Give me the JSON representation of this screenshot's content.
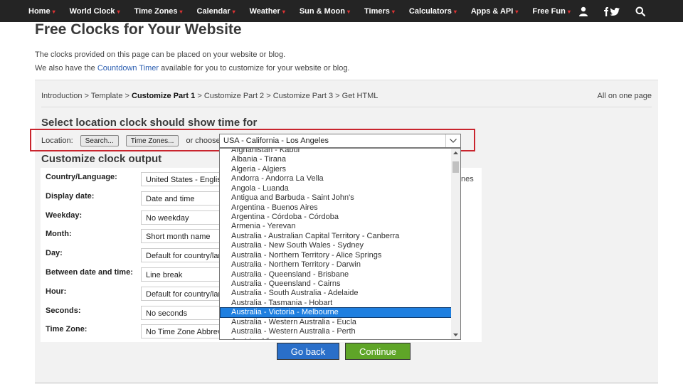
{
  "nav": {
    "items": [
      {
        "label": "Home",
        "caret": "▾"
      },
      {
        "label": "World Clock",
        "caret": "▾"
      },
      {
        "label": "Time Zones",
        "caret": "▾"
      },
      {
        "label": "Calendar",
        "caret": "▾"
      },
      {
        "label": "Weather",
        "caret": "▾"
      },
      {
        "label": "Sun & Moon",
        "caret": "▾"
      },
      {
        "label": "Timers",
        "caret": "▾"
      },
      {
        "label": "Calculators",
        "caret": "▾"
      },
      {
        "label": "Apps & API",
        "caret": "▾"
      },
      {
        "label": "Free Fun",
        "caret": "▾"
      }
    ],
    "icons": [
      "user-icon",
      "facebook-twitter-icon",
      "search-icon"
    ]
  },
  "page": {
    "title": "Free Clocks for Your Website",
    "intro1": "The clocks provided on this page can be placed on your website or blog.",
    "intro2_pre": "We also have the ",
    "intro2_link": "Countdown Timer",
    "intro2_post": " available for you to customize for your website or blog."
  },
  "breadcrumb": {
    "items": [
      "Introduction",
      "Template",
      "Customize Part 1",
      "Customize Part 2",
      "Customize Part 3",
      "Get HTML"
    ],
    "separator": " > ",
    "all_on_one": "All on one page"
  },
  "location": {
    "heading": "Select location clock should show time for",
    "label": "Location:",
    "search_btn": "Search...",
    "tz_btn": "Time Zones...",
    "or_choose": "or choose:",
    "selected": "USA - California - Los Angeles"
  },
  "customize": {
    "heading": "Customize clock output",
    "rows": [
      {
        "label": "Country/Language:",
        "value": "United States - English"
      },
      {
        "label": "Display date:",
        "value": "Date and time"
      },
      {
        "label": "Weekday:",
        "value": "No weekday"
      },
      {
        "label": "Month:",
        "value": "Short month name"
      },
      {
        "label": "Day:",
        "value": "Default for country/language"
      },
      {
        "label": "Between date and time:",
        "value": "Line break"
      },
      {
        "label": "Hour:",
        "value": "Default for country/language"
      },
      {
        "label": "Seconds:",
        "value": "No seconds"
      },
      {
        "label": "Time Zone:",
        "value": "No Time Zone Abbreviation"
      }
    ],
    "side_text": "nes"
  },
  "dropdown": {
    "options": [
      "Afghanistan - Kabul",
      "Albania - Tirana",
      "Algeria - Algiers",
      "Andorra - Andorra La Vella",
      "Angola - Luanda",
      "Antigua and Barbuda - Saint John's",
      "Argentina - Buenos Aires",
      "Argentina - Córdoba - Córdoba",
      "Armenia - Yerevan",
      "Australia - Australian Capital Territory - Canberra",
      "Australia - New South Wales - Sydney",
      "Australia - Northern Territory - Alice Springs",
      "Australia - Northern Territory - Darwin",
      "Australia - Queensland - Brisbane",
      "Australia - Queensland - Cairns",
      "Australia - South Australia - Adelaide",
      "Australia - Tasmania - Hobart",
      "Australia - Victoria - Melbourne",
      "Australia - Western Australia - Eucla",
      "Australia - Western Australia - Perth",
      "Austria - Vienna"
    ],
    "selected_index": 17
  },
  "actions": {
    "back": "Go back",
    "continue": "Continue"
  }
}
